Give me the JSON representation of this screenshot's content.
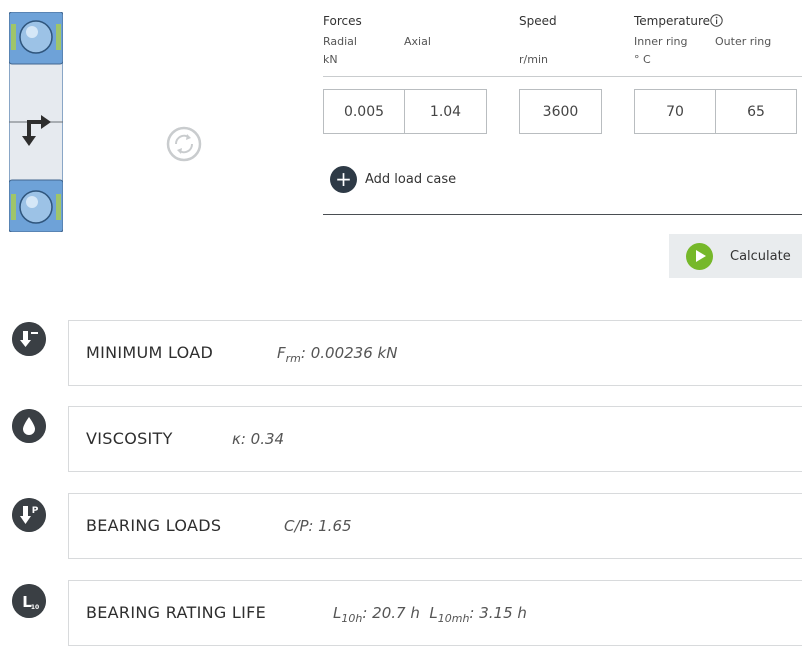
{
  "inputs": {
    "forces": {
      "label": "Forces",
      "radial_label": "Radial",
      "axial_label": "Axial",
      "unit": "kN",
      "radial_value": "0.005",
      "axial_value": "1.04"
    },
    "speed": {
      "label": "Speed",
      "unit": "r/min",
      "value": "3600"
    },
    "temperature": {
      "label": "Temperature",
      "info_icon": "info-icon",
      "inner_label": "Inner ring",
      "outer_label": "Outer ring",
      "unit": "° C",
      "inner_value": "70",
      "outer_value": "65"
    }
  },
  "actions": {
    "add_load_case": "Add load case",
    "calculate": "Calculate"
  },
  "results": [
    {
      "title": "MINIMUM LOAD",
      "icon": "minimum-load-icon",
      "symbol": "F",
      "symbol_sub": "rm",
      "value": ": 0.00236 kN"
    },
    {
      "title": "VISCOSITY",
      "icon": "viscosity-drop-icon",
      "symbol": "κ",
      "value": ": 0.34"
    },
    {
      "title": "BEARING LOADS",
      "icon": "bearing-loads-icon",
      "symbol": "C/P",
      "value": ": 1.65"
    },
    {
      "title": "BEARING RATING LIFE",
      "icon": "rating-life-icon",
      "symbol": "L",
      "symbol_sub": "10h",
      "value": ": 20.7 h",
      "symbol2": "L",
      "symbol2_sub": "10mh",
      "value2": ": 3.15 h"
    }
  ],
  "colors": {
    "accent_green": "#76b82a",
    "dark_icon": "#3a3f44",
    "bearing_blue": "#5b93cf"
  }
}
